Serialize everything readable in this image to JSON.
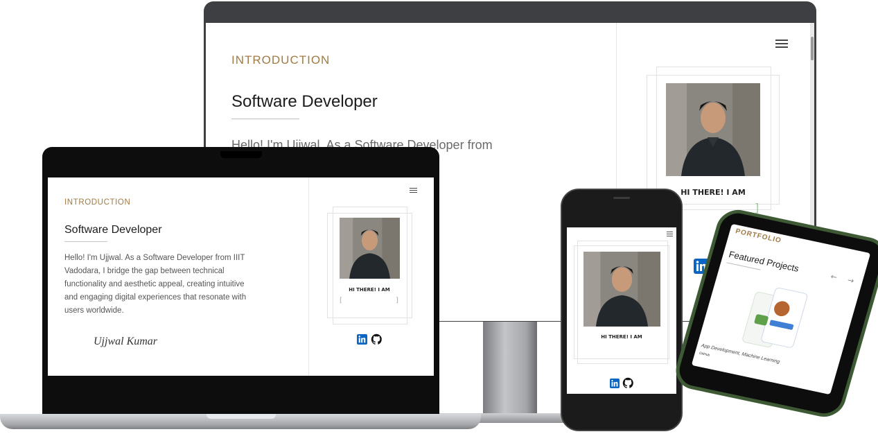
{
  "site": {
    "section_label": "INTRODUCTION",
    "role": "Software Developer",
    "bio": "Hello! I'm Ujjwal. As a Software Developer from IIIT Vadodara, I bridge the gap between technical functionality and aesthetic appeal, creating intuitive and engaging digital experiences that resonate with users worldwide.",
    "greeting": "HI THERE! I AM",
    "signature": "Ujjwal Kumar",
    "brand_color": "#a07a45",
    "icons": [
      "menu-icon",
      "linkedin-icon",
      "github-icon"
    ]
  },
  "monitor": {
    "bio_visible": "Hello! I'm Ujjwal. As a Software Developer from\neen technical\nreating\nences that",
    "bracket": "]"
  },
  "laptop": {
    "bracket_left": "[",
    "bracket_right": "]"
  },
  "phone2": {
    "brand": "PORTFOLIO",
    "title": "Featured Projects",
    "arrows": "← →",
    "project_caption": "App Development, Machine Learning",
    "github_label": "GitHub"
  }
}
